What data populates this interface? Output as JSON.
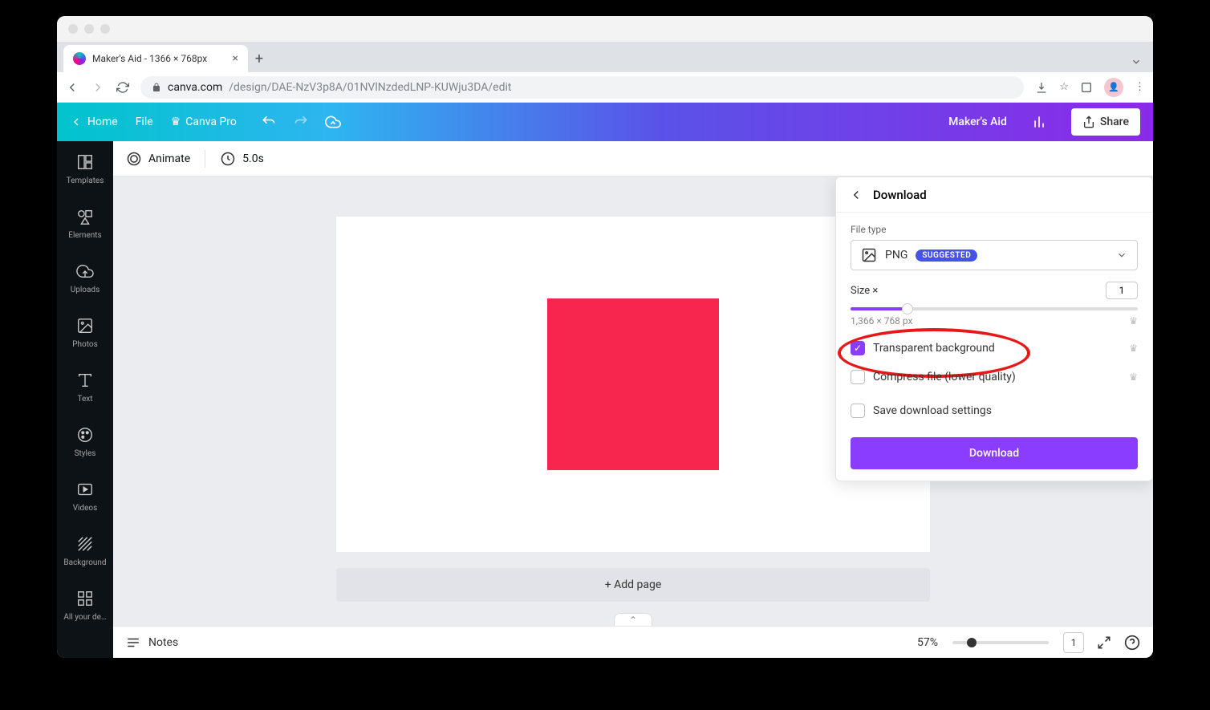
{
  "browser": {
    "tab_title": "Maker's Aid - 1366 × 768px",
    "url_host": "canva.com",
    "url_path": "/design/DAE-NzV3p8A/01NVlNzdedLNP-KUWju3DA/edit"
  },
  "topbar": {
    "back_label": "Home",
    "file_label": "File",
    "pro_label": "Canva Pro",
    "project_name": "Maker's Aid",
    "share_label": "Share"
  },
  "sidebar": {
    "items": [
      {
        "label": "Templates"
      },
      {
        "label": "Elements"
      },
      {
        "label": "Uploads"
      },
      {
        "label": "Photos"
      },
      {
        "label": "Text"
      },
      {
        "label": "Styles"
      },
      {
        "label": "Videos"
      },
      {
        "label": "Background"
      },
      {
        "label": "All your de…"
      }
    ]
  },
  "toolbar": {
    "animate": "Animate",
    "duration": "5.0s"
  },
  "canvas": {
    "add_page": "+ Add page"
  },
  "download_panel": {
    "title": "Download",
    "file_type_label": "File type",
    "file_type_value": "PNG",
    "suggested_badge": "SUGGESTED",
    "size_label": "Size ×",
    "size_value": "1",
    "dimensions": "1,366 × 768 px",
    "opt_transparent": "Transparent background",
    "opt_compress": "Compress file (lower quality)",
    "opt_save": "Save download settings",
    "button": "Download"
  },
  "footer": {
    "notes": "Notes",
    "zoom": "57%",
    "page_indicator": "1"
  }
}
